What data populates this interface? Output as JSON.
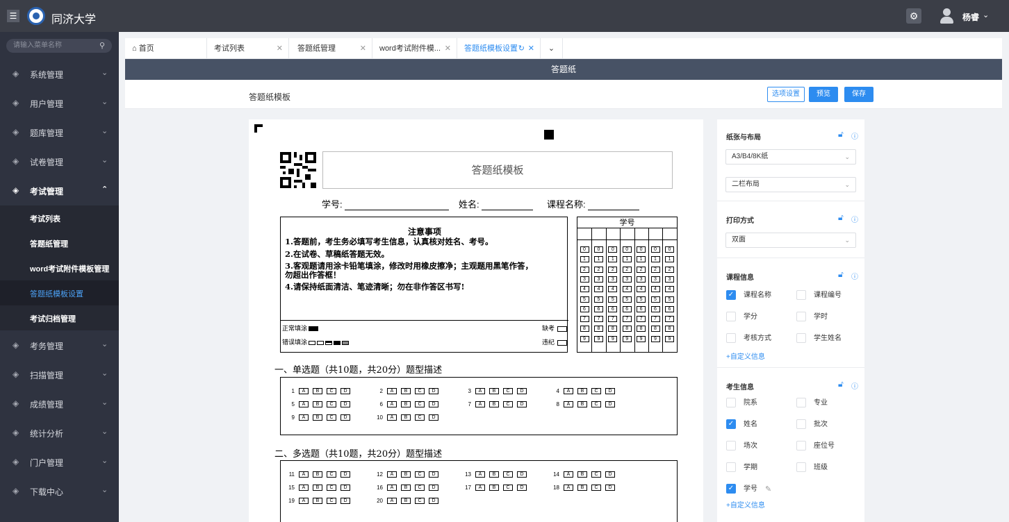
{
  "header": {
    "brand": "同济大学",
    "user": "杨睿",
    "menu_icon": "menu-icon",
    "settings_icon": "gear-icon"
  },
  "sidebar": {
    "search_placeholder": "请输入菜单名称",
    "items": [
      {
        "label": "系统管理"
      },
      {
        "label": "用户管理"
      },
      {
        "label": "题库管理"
      },
      {
        "label": "试卷管理"
      },
      {
        "label": "考试管理"
      }
    ],
    "sub_items": [
      {
        "label": "考试列表"
      },
      {
        "label": "答题纸管理"
      },
      {
        "label": "word考试附件模板管理"
      },
      {
        "label": "答题纸模板设置"
      },
      {
        "label": "考试归档管理"
      }
    ],
    "items_after": [
      {
        "label": "考务管理"
      },
      {
        "label": "扫描管理"
      },
      {
        "label": "成绩管理"
      },
      {
        "label": "统计分析"
      },
      {
        "label": "门户管理"
      },
      {
        "label": "下载中心"
      }
    ]
  },
  "tabs": [
    {
      "label": "首页"
    },
    {
      "label": "考试列表"
    },
    {
      "label": "答题纸管理"
    },
    {
      "label": "word考试附件模..."
    },
    {
      "label": "答题纸模板设置"
    }
  ],
  "title_bar": "答题纸",
  "actions": {
    "template_title": "答题纸模板",
    "options": "选项设置",
    "preview": "预览",
    "save": "保存"
  },
  "sheet": {
    "title": "答题纸模板",
    "student_fields": {
      "id": "学号:",
      "name": "姓名:",
      "course": "课程名称:"
    },
    "notice_title": "注意事项",
    "notice": [
      "1.答题前，考生务必填写考生信息，认真核对姓名、考号。",
      "2.在试卷、草稿纸答题无效。",
      "3.客观题请用涂卡铅笔填涂，修改时用橡皮擦净；主观题用黑笔作答，",
      "勿超出作答框！",
      "4.请保持纸面清洁、笔迹清晰；勿在非作答区书写!"
    ],
    "fill_ok": "正常填涂",
    "fill_bad": "错误填涂",
    "absent": "缺考",
    "violation": "违纪",
    "id_header": "学号",
    "digits": [
      "0",
      "1",
      "2",
      "3",
      "4",
      "5",
      "6",
      "7",
      "8",
      "9"
    ],
    "section1_title": "一、单选题（共10题，共20分）题型描述",
    "section2_title": "二、多选题（共10题，共20分）题型描述",
    "options": [
      "A",
      "B",
      "C",
      "D"
    ],
    "section1_questions": [
      "1",
      "2",
      "3",
      "4",
      "5",
      "6",
      "7",
      "8",
      "9",
      "10"
    ],
    "section2_questions": [
      "11",
      "12",
      "13",
      "14",
      "15",
      "16",
      "17",
      "18",
      "19",
      "20"
    ]
  },
  "panel": {
    "paper_layout": {
      "title": "纸张与布局",
      "paper": "A3/B4/8K纸",
      "layout": "二栏布局"
    },
    "print": {
      "title": "打印方式",
      "mode": "双面"
    },
    "course_info": {
      "title": "课程信息",
      "items": [
        {
          "label": "课程名称",
          "checked": true
        },
        {
          "label": "课程编号",
          "checked": false
        },
        {
          "label": "学分",
          "checked": false
        },
        {
          "label": "学时",
          "checked": false
        },
        {
          "label": "考核方式",
          "checked": false
        },
        {
          "label": "学生姓名",
          "checked": false
        }
      ],
      "add": "+自定义信息"
    },
    "student_info": {
      "title": "考生信息",
      "items": [
        {
          "label": "院系",
          "checked": false
        },
        {
          "label": "专业",
          "checked": false
        },
        {
          "label": "姓名",
          "checked": true
        },
        {
          "label": "批次",
          "checked": false
        },
        {
          "label": "场次",
          "checked": false
        },
        {
          "label": "座位号",
          "checked": false
        },
        {
          "label": "学期",
          "checked": false
        },
        {
          "label": "班级",
          "checked": false
        },
        {
          "label": "学号",
          "checked": true
        }
      ],
      "add": "+自定义信息"
    }
  },
  "colors": {
    "accent": "#2d8cf0",
    "sidebar": "#2f3340",
    "topbar": "#3b3e47",
    "titlebar": "#475265"
  }
}
